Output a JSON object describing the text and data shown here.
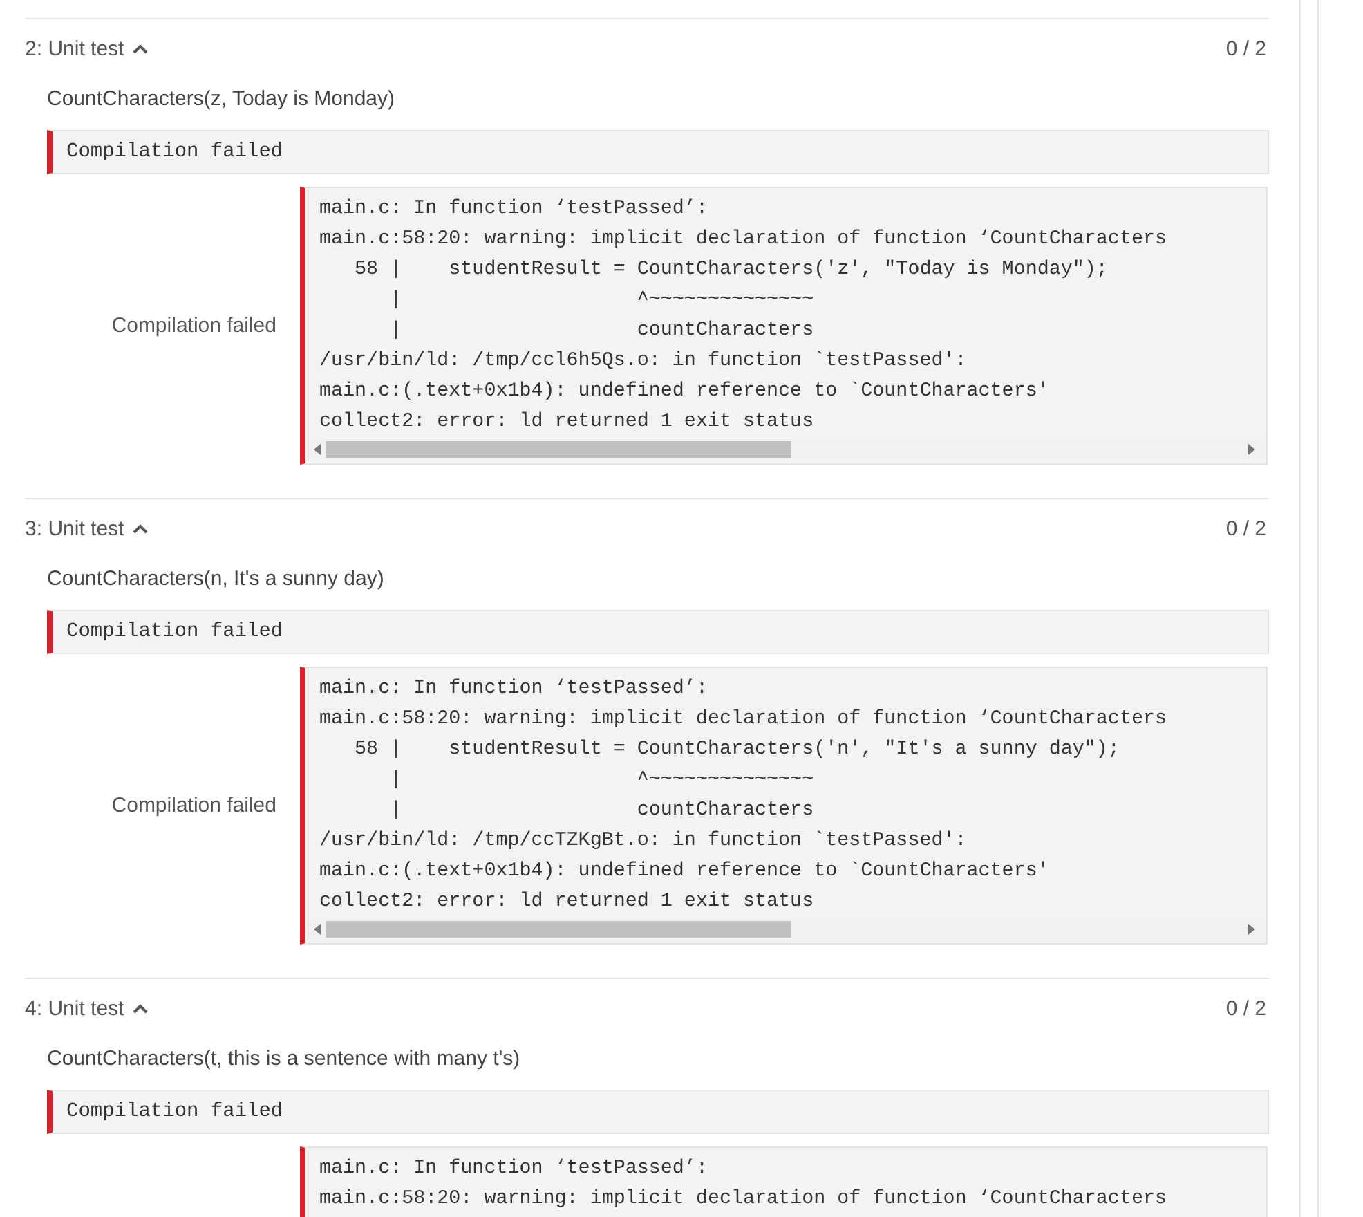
{
  "tests": [
    {
      "number": "2:",
      "title": "Unit test",
      "expanded": true,
      "score": "0 / 2",
      "description": "CountCharacters(z, Today is Monday)",
      "banner": "Compilation failed",
      "output_label": "Compilation failed",
      "output_lines": [
        "main.c: In function ‘testPassed’:",
        "main.c:58:20: warning: implicit declaration of function ‘CountCharacters",
        "   58 |    studentResult = CountCharacters('z', \"Today is Monday\");",
        "      |                    ^~~~~~~~~~~~~~~",
        "      |                    countCharacters",
        "/usr/bin/ld: /tmp/ccl6h5Qs.o: in function `testPassed':",
        "main.c:(.text+0x1b4): undefined reference to `CountCharacters'",
        "collect2: error: ld returned 1 exit status"
      ]
    },
    {
      "number": "3:",
      "title": "Unit test",
      "expanded": true,
      "score": "0 / 2",
      "description": "CountCharacters(n, It's a sunny day)",
      "banner": "Compilation failed",
      "output_label": "Compilation failed",
      "output_lines": [
        "main.c: In function ‘testPassed’:",
        "main.c:58:20: warning: implicit declaration of function ‘CountCharacters",
        "   58 |    studentResult = CountCharacters('n', \"It's a sunny day\");",
        "      |                    ^~~~~~~~~~~~~~~",
        "      |                    countCharacters",
        "/usr/bin/ld: /tmp/ccTZKgBt.o: in function `testPassed':",
        "main.c:(.text+0x1b4): undefined reference to `CountCharacters'",
        "collect2: error: ld returned 1 exit status"
      ]
    },
    {
      "number": "4:",
      "title": "Unit test",
      "expanded": true,
      "score": "0 / 2",
      "description": "CountCharacters(t, this is a sentence with many t's)",
      "banner": "Compilation failed",
      "output_lines": [
        "main.c: In function ‘testPassed’:",
        "main.c:58:20: warning: implicit declaration of function ‘CountCharacters"
      ]
    }
  ]
}
